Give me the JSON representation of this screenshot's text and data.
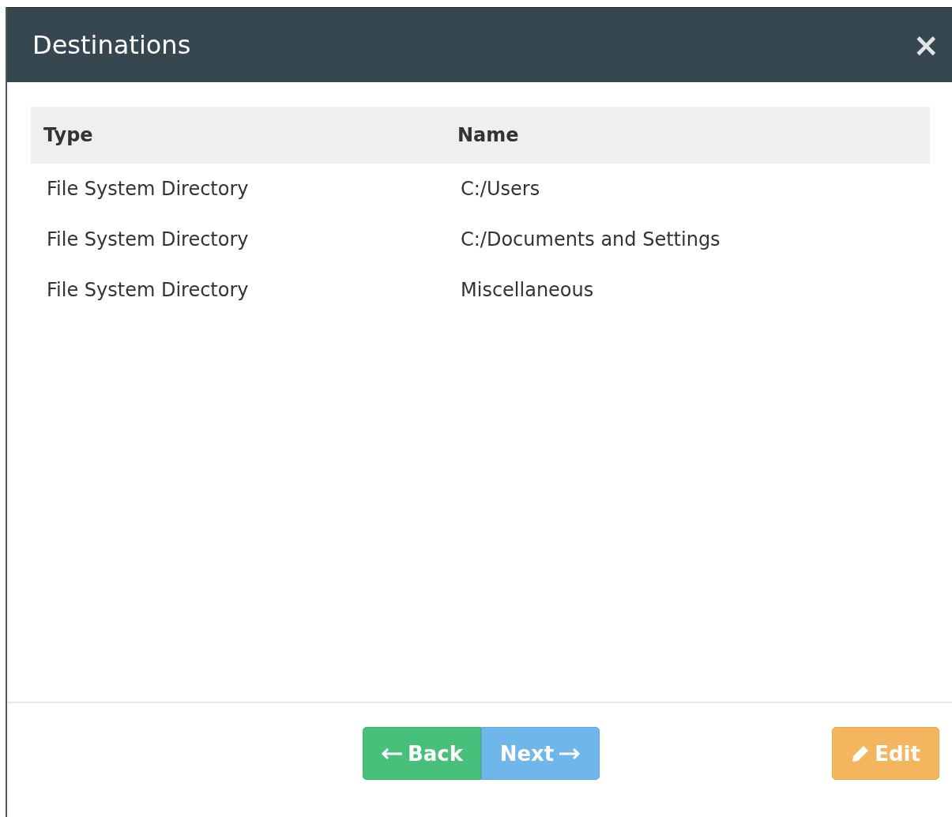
{
  "window": {
    "title": "Destinations",
    "close": "×"
  },
  "table": {
    "columns": [
      "Type",
      "Name"
    ],
    "rows": [
      [
        "File System Directory",
        "C:/Users"
      ],
      [
        "File System Directory",
        "C:/Documents and Settings"
      ],
      [
        "File System Directory",
        "Miscellaneous"
      ]
    ]
  },
  "buttons": [
    {
      "label": "Back",
      "kind": "back"
    },
    {
      "label": "Next",
      "kind": "next"
    },
    {
      "label": "Edit",
      "kind": "edit"
    }
  ]
}
